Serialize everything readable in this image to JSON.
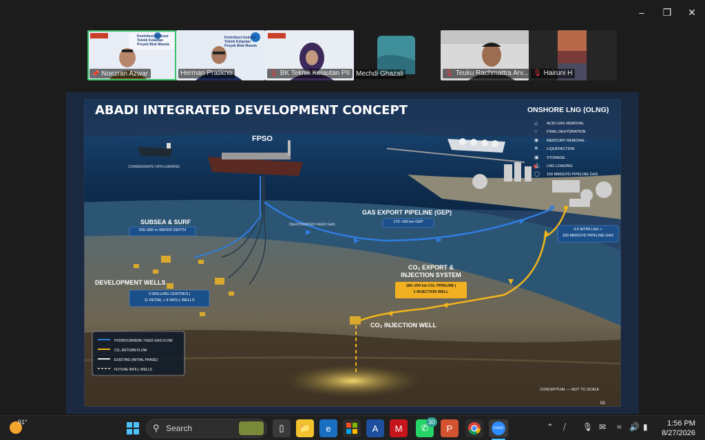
{
  "participants": [
    {
      "name": "Noezran Azwar",
      "pinned": true,
      "muted": false,
      "active": true
    },
    {
      "name": "Herman Pratikno",
      "pinned": false,
      "muted": false,
      "active": false
    },
    {
      "name": "BK Teknik Kelautan PII",
      "pinned": false,
      "muted": true,
      "active": false
    },
    {
      "name": "Mechdi Ghazali",
      "pinned": false,
      "muted": false,
      "active": false
    },
    {
      "name": "Teuku Rachmattra Arv...",
      "pinned": false,
      "muted": true,
      "active": false
    },
    {
      "name": "Hairuni H",
      "pinned": false,
      "muted": true,
      "active": false
    }
  ],
  "tile_banner": {
    "line1": "Kontribusi Insinyur Teknik Kelautan",
    "line2": "Proyek Blok Masela"
  },
  "slide": {
    "title": "ABADI INTEGRATED DEVELOPMENT CONCEPT",
    "onshore": {
      "title": "ONSHORE LNG (OLNG)",
      "items": [
        "ACID-GAS REMOVAL",
        "FINAL DEHYDRATION",
        "MERCURY REMOVAL",
        "LIQUEFACTION",
        "STORAGE",
        "LNG LOADING",
        "150 MMSCFD PIPELINE GAS"
      ]
    },
    "fpso": "FPSO",
    "condensate": "CONDENSATE OFFLOADING",
    "subsea": {
      "title": "SUBSEA & SURF",
      "box": "600–800 m WATER DEPTH"
    },
    "dehydrated": "DEHYDRATED FEED GAS",
    "gep": {
      "title": "GAS EXPORT PIPELINE (GEP)",
      "box": "170–180 km GEP"
    },
    "capacity": {
      "line1": "9.5 MTPA LNG +",
      "line2": "150 MMSCFD PIPELINE GAS"
    },
    "co2_export": {
      "line1": "CO₂ EXPORT &",
      "line2": "INJECTION SYSTEM",
      "box1": "180–200 km CO₂ PIPELINE |",
      "box2": "1 INJECTION WELL"
    },
    "wells": {
      "title": "DEVELOPMENT WELLS",
      "box1": "3 DRILLING CENTRES |",
      "box2": "11 INITIAL + 4 INFILL WELLS"
    },
    "co2_well": "CO₂ INJECTION WELL",
    "legend": [
      "HYDROCARBON / FEED GAS FLOW",
      "CO₂ RETURN FLOW",
      "EXISTING (INITIAL PHASE)",
      "FUTURE INFILL WELLS"
    ],
    "note": "CONCEPTUAL — NOT TO SCALE",
    "page": "03"
  },
  "taskbar": {
    "weather": "91°",
    "search_placeholder": "Search",
    "whatsapp_badge": "30",
    "time": "1:56 PM",
    "date": "8/27/2026"
  },
  "colors": {
    "flow_blue": "#2f7de1",
    "flow_yellow": "#f3b51b",
    "sea_dark": "#0c2746",
    "accent_green": "#39c26b"
  }
}
